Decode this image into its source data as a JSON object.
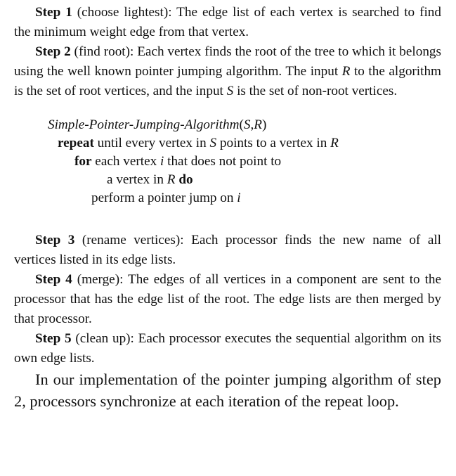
{
  "step1": {
    "label": "Step 1",
    "title": " (choose lightest): ",
    "text": "The edge list of each vertex is searched to find the minimum weight edge from that vertex."
  },
  "step2": {
    "label": "Step 2",
    "title": " (find root): ",
    "text_a": "Each vertex finds the root of the tree to which it belongs using the well known pointer jumping algorithm. The input ",
    "var_R": "R",
    "text_b": " to the algorithm is the set of root vertices, and the input ",
    "var_S": "S",
    "text_c": " is the set of non-root vertices."
  },
  "algorithm": {
    "name": "Simple-Pointer-Jumping-Algorithm",
    "args_open": "(",
    "arg_S": "S",
    "args_comma": ",",
    "arg_R": "R",
    "args_close": ")",
    "line1_kw": "repeat",
    "line1_a": " until every vertex in ",
    "line1_S": "S",
    "line1_b": " points to a vertex in ",
    "line1_R": "R",
    "line2_kw": "for",
    "line2_a": " each vertex ",
    "line2_i": "i",
    "line2_b": " that does not point to",
    "line3_a": "a vertex in ",
    "line3_R": "R",
    "line3_kw": " do",
    "line4_a": "perform a pointer jump on ",
    "line4_i": "i"
  },
  "step3": {
    "label": "Step 3",
    "title": " (rename vertices): ",
    "text": "Each processor finds the new name of all vertices listed in its edge lists."
  },
  "step4": {
    "label": "Step 4",
    "title": " (merge): ",
    "text": "The edges of all vertices in a component are sent to the processor that has the edge list of the root. The edge lists are then merged by that processor."
  },
  "step5": {
    "label": "Step 5",
    "title": " (clean up): ",
    "text": "Each processor executes the sequential algorithm on its own edge lists."
  },
  "closing": {
    "text": "In our implementation of the pointer jumping algorithm of step 2, processors synchronize at each iteration of the repeat loop."
  }
}
